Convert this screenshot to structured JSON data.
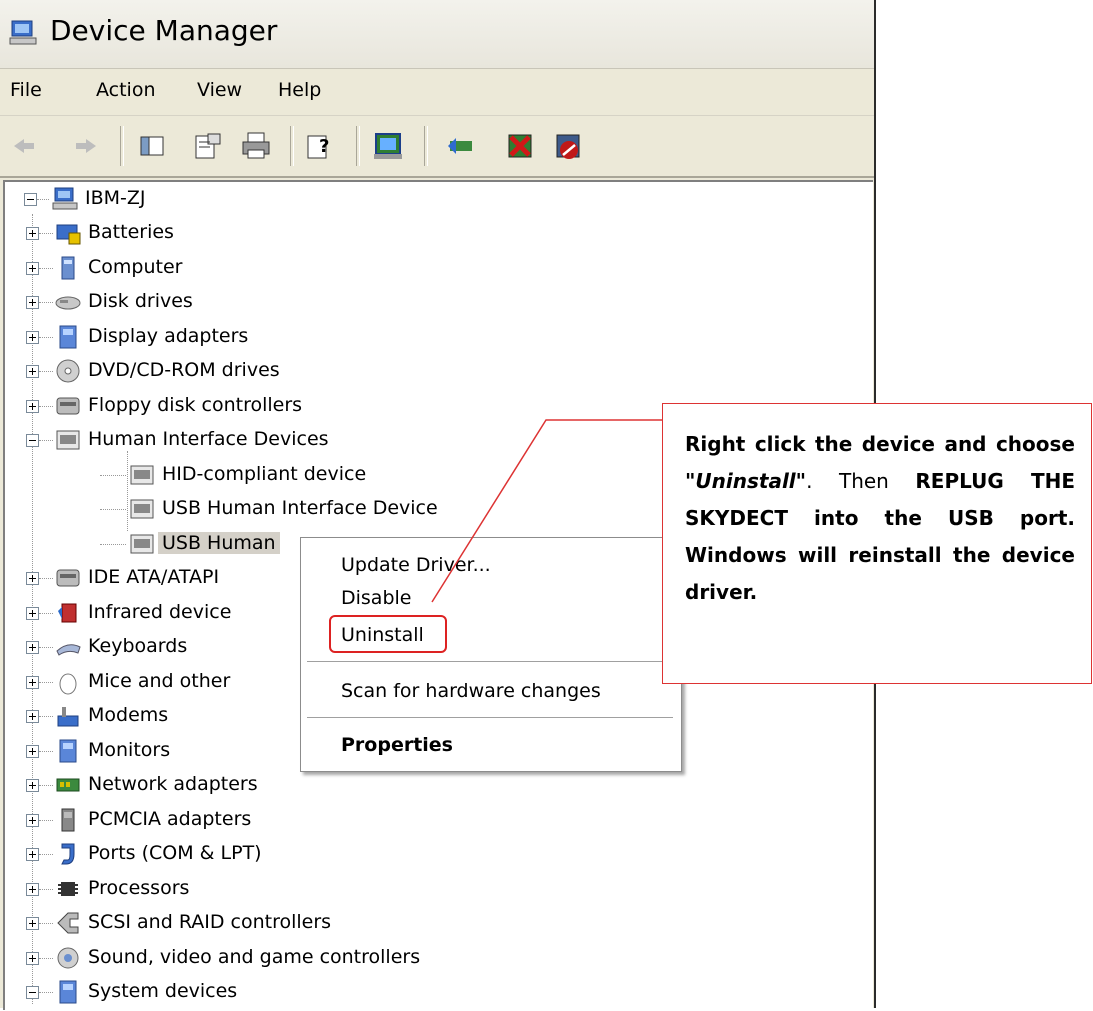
{
  "window": {
    "title": "Device Manager",
    "app_icon": "computer-icon"
  },
  "menu": {
    "items": [
      "File",
      "Action",
      "View",
      "Help"
    ]
  },
  "toolbar": {
    "buttons": [
      "back-arrow-icon",
      "forward-arrow-icon",
      "show-hide-console-tree-icon",
      "properties-icon",
      "print-icon",
      "help-icon",
      "scan-hardware-icon",
      "update-driver-icon",
      "uninstall-icon",
      "disable-icon"
    ]
  },
  "tree": {
    "root": "IBM-ZJ",
    "categories": [
      {
        "label": "Batteries",
        "icon": "battery-icon"
      },
      {
        "label": "Computer",
        "icon": "computer-icon"
      },
      {
        "label": "Disk drives",
        "icon": "disk-drive-icon"
      },
      {
        "label": "Display adapters",
        "icon": "display-adapter-icon"
      },
      {
        "label": "DVD/CD-ROM drives",
        "icon": "dvd-drive-icon"
      },
      {
        "label": "Floppy disk controllers",
        "icon": "floppy-controller-icon"
      },
      {
        "label": "Human Interface Devices",
        "icon": "hid-icon",
        "expanded": true
      },
      {
        "label": "IDE ATA/ATAPI",
        "icon": "ide-controller-icon"
      },
      {
        "label": "Infrared device",
        "icon": "infrared-icon"
      },
      {
        "label": "Keyboards",
        "icon": "keyboard-icon"
      },
      {
        "label": "Mice and other",
        "icon": "mouse-icon"
      },
      {
        "label": "Modems",
        "icon": "modem-icon"
      },
      {
        "label": "Monitors",
        "icon": "monitor-icon"
      },
      {
        "label": "Network adapters",
        "icon": "network-adapter-icon"
      },
      {
        "label": "PCMCIA adapters",
        "icon": "pcmcia-icon"
      },
      {
        "label": "Ports (COM & LPT)",
        "icon": "port-icon"
      },
      {
        "label": "Processors",
        "icon": "processor-icon"
      },
      {
        "label": "SCSI and RAID controllers",
        "icon": "scsi-icon"
      },
      {
        "label": "Sound, video and game controllers",
        "icon": "sound-icon"
      },
      {
        "label": "System devices",
        "icon": "system-icon",
        "expanded": true
      }
    ],
    "hid_children": [
      "HID-compliant device",
      "USB Human Interface Device",
      "USB Human"
    ]
  },
  "context_menu": {
    "items": [
      "Update Driver...",
      "Disable",
      "Uninstall",
      "Scan for hardware changes",
      "Properties"
    ],
    "highlighted": "Uninstall"
  },
  "callout": {
    "part1": "Right click the device and choose ",
    "quote": "\"Uninstall\"",
    "part2": ". Then ",
    "bold": "REPLUG THE SKYDECT",
    "part3": " into the USB port. Windows will reinstall the device driver."
  },
  "colors": {
    "window_bg": "#ece9d8",
    "callout_border": "#dd3333",
    "highlight": "#dd2222"
  }
}
